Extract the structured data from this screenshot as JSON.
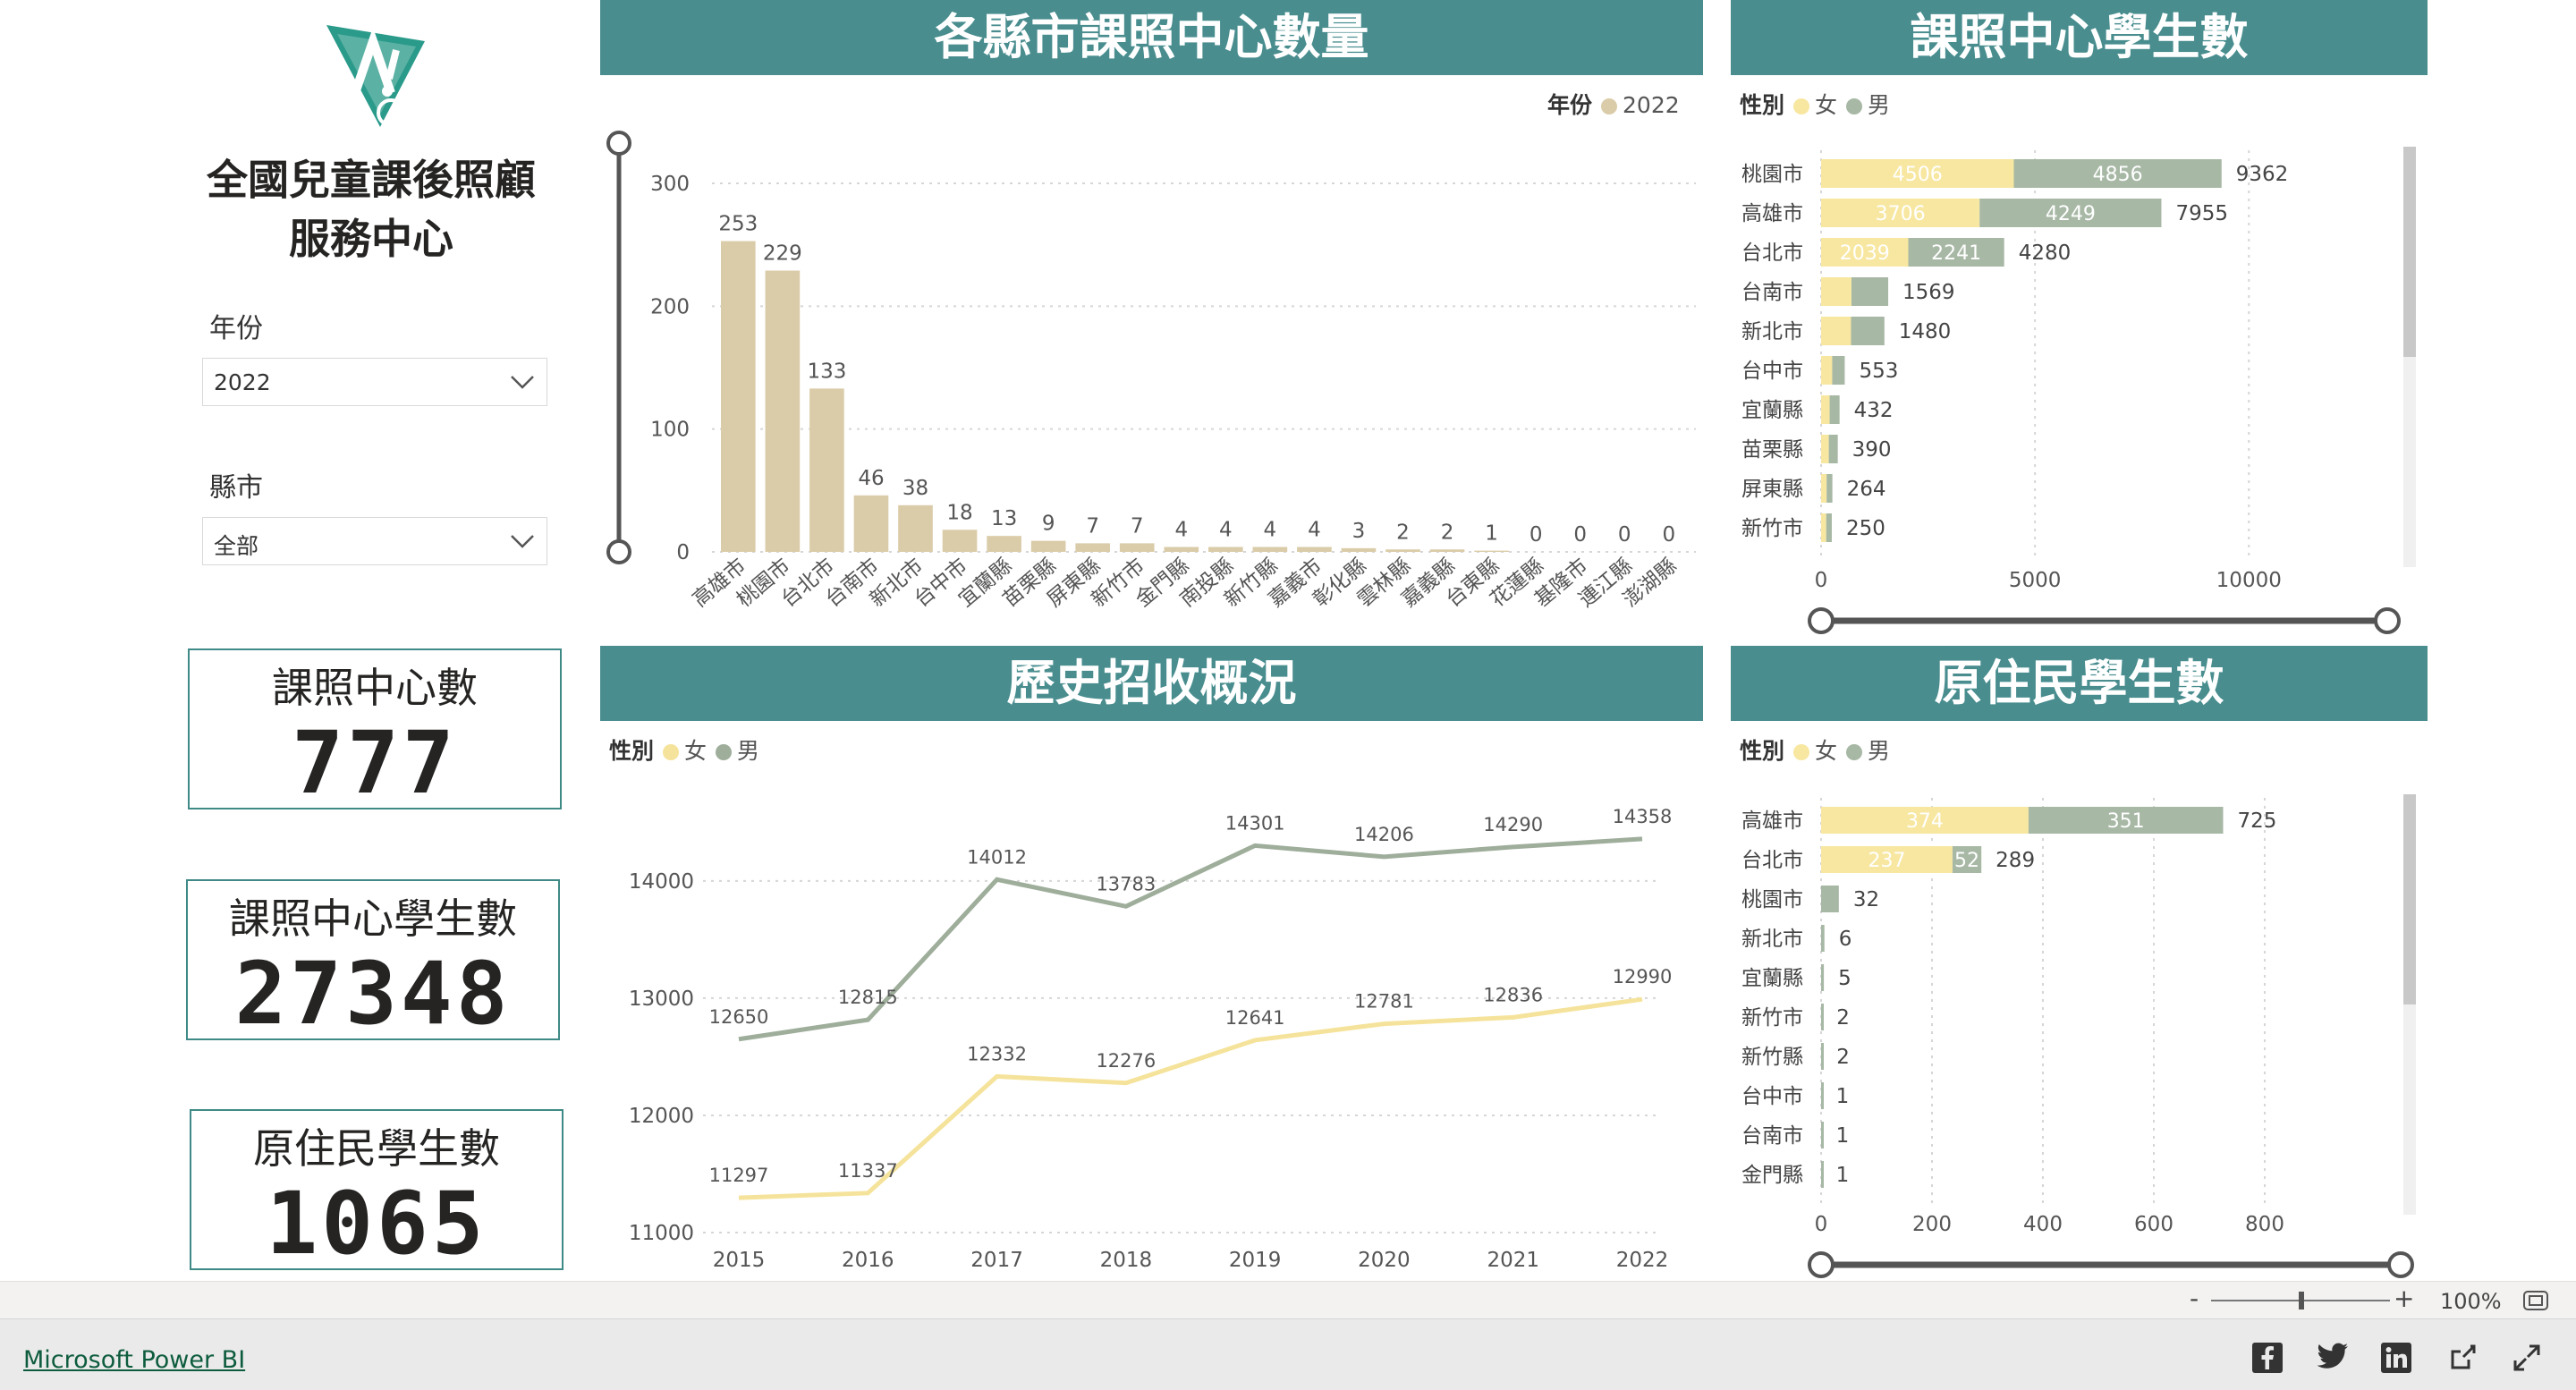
{
  "report": {
    "title_line1": "全國兒童課後照顧",
    "title_line2": "服務中心"
  },
  "slicers": [
    {
      "label": "年份",
      "value": "2022"
    },
    {
      "label": "縣市",
      "value": "全部"
    }
  ],
  "cards": [
    {
      "title": "課照中心數",
      "value": "777"
    },
    {
      "title": "課照中心學生數",
      "value": "27348"
    },
    {
      "title": "原住民學生數",
      "value": "1065"
    }
  ],
  "colors": {
    "banner": "#498d8f",
    "bar_year": "#dbcca9",
    "female": "#f7e7a1",
    "male": "#a7b8a5",
    "line_female": "#f5e39b",
    "line_male": "#9eae9b",
    "card_border": "#3f8a86"
  },
  "chart_data": [
    {
      "type": "bar",
      "title": "各縣市課照中心數量",
      "legend_title": "年份",
      "series": [
        {
          "name": "2022",
          "values": [
            253,
            229,
            133,
            46,
            38,
            18,
            13,
            9,
            7,
            7,
            4,
            4,
            4,
            4,
            3,
            2,
            2,
            1,
            0,
            0,
            0,
            0
          ]
        }
      ],
      "categories": [
        "高雄市",
        "桃園市",
        "台北市",
        "台南市",
        "新北市",
        "台中市",
        "宜蘭縣",
        "苗栗縣",
        "屏東縣",
        "新竹市",
        "金門縣",
        "南投縣",
        "新竹縣",
        "嘉義市",
        "彰化縣",
        "雲林縣",
        "嘉義縣",
        "台東縣",
        "花蓮縣",
        "基隆市",
        "連江縣",
        "澎湖縣"
      ],
      "yticks": [
        0,
        100,
        200,
        300
      ],
      "ylim": [
        0,
        300
      ],
      "legend_position": "top-right"
    },
    {
      "type": "bar",
      "orientation": "horizontal",
      "stacked": true,
      "title": "課照中心學生數",
      "legend_title": "性別",
      "categories": [
        "桃園市",
        "高雄市",
        "台北市",
        "台南市",
        "新北市",
        "台中市",
        "宜蘭縣",
        "苗栗縣",
        "屏東縣",
        "新竹市"
      ],
      "series": [
        {
          "name": "女",
          "values": [
            4506,
            3706,
            2039,
            710,
            700,
            260,
            200,
            180,
            130,
            120
          ]
        },
        {
          "name": "男",
          "values": [
            4856,
            4249,
            2241,
            859,
            780,
            293,
            232,
            210,
            134,
            130
          ]
        }
      ],
      "totals": [
        9362,
        7955,
        4280,
        1569,
        1480,
        553,
        432,
        390,
        264,
        250
      ],
      "xticks": [
        0,
        5000,
        10000
      ],
      "xlim": [
        0,
        11500
      ],
      "legend_position": "top-left"
    },
    {
      "type": "line",
      "title": "歷史招收概況",
      "legend_title": "性別",
      "x": [
        "2015",
        "2016",
        "2017",
        "2018",
        "2019",
        "2020",
        "2021",
        "2022"
      ],
      "series": [
        {
          "name": "女",
          "values": [
            11297,
            11337,
            12332,
            12276,
            12641,
            12781,
            12836,
            12990
          ]
        },
        {
          "name": "男",
          "values": [
            12650,
            12815,
            14012,
            13783,
            14301,
            14206,
            14290,
            14358
          ]
        }
      ],
      "yticks": [
        11000,
        12000,
        13000,
        14000
      ],
      "ylim": [
        11000,
        14800
      ],
      "legend_position": "top-left"
    },
    {
      "type": "bar",
      "orientation": "horizontal",
      "stacked": true,
      "title": "原住民學生數",
      "legend_title": "性別",
      "categories": [
        "高雄市",
        "台北市",
        "桃園市",
        "新北市",
        "宜蘭縣",
        "新竹市",
        "新竹縣",
        "台中市",
        "台南市",
        "金門縣"
      ],
      "series": [
        {
          "name": "女",
          "values": [
            374,
            237,
            0,
            0,
            0,
            0,
            0,
            0,
            0,
            0
          ]
        },
        {
          "name": "男",
          "values": [
            351,
            52,
            32,
            6,
            5,
            2,
            2,
            1,
            1,
            1
          ]
        }
      ],
      "totals": [
        725,
        289,
        32,
        6,
        5,
        2,
        2,
        1,
        1,
        1
      ],
      "xticks": [
        0,
        200,
        400,
        600,
        800
      ],
      "xlim": [
        0,
        900
      ],
      "legend_position": "top-left"
    }
  ],
  "statusbar": {
    "zoom": "100%",
    "minus": "-",
    "plus": "+"
  },
  "footer": {
    "brand": "Microsoft Power BI"
  },
  "icons": [
    "facebook-icon",
    "twitter-icon",
    "linkedin-icon",
    "share-icon",
    "fullscreen-icon",
    "fit-page-icon"
  ]
}
